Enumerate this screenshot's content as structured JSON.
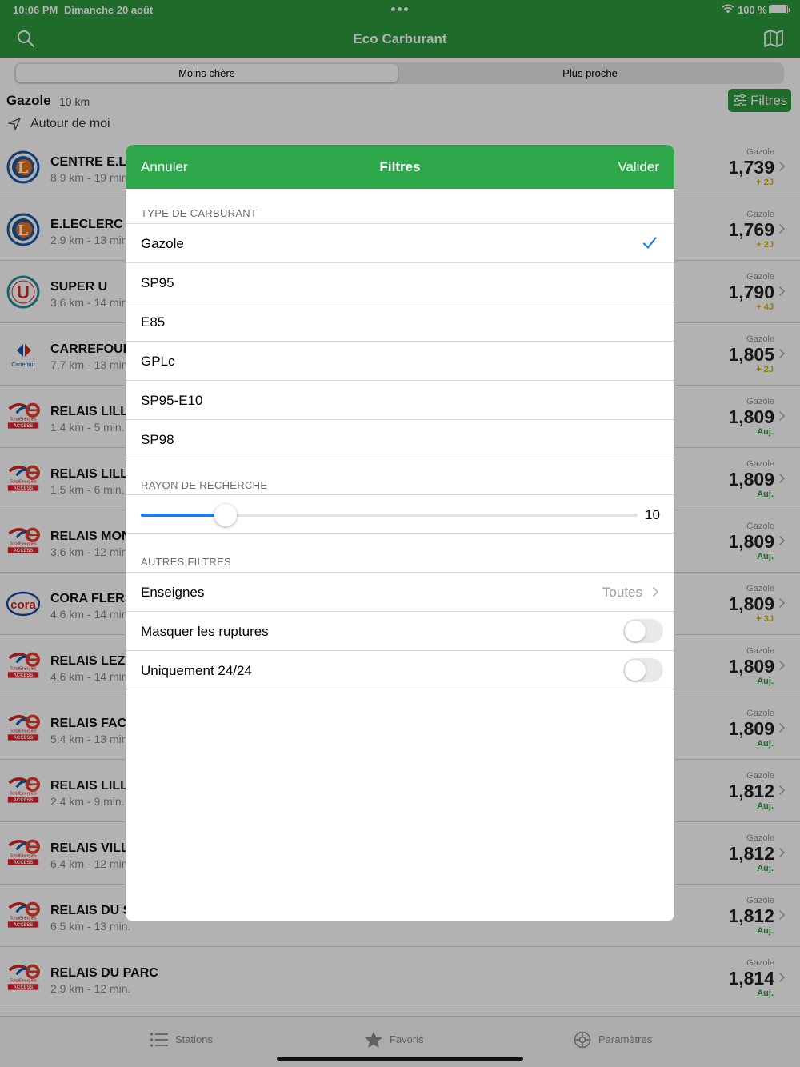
{
  "status": {
    "time": "10:06 PM",
    "date": "Dimanche 20 août",
    "battery": "100 %"
  },
  "nav": {
    "title": "Eco Carburant"
  },
  "segments": {
    "cheapest": "Moins chère",
    "nearest": "Plus proche"
  },
  "header": {
    "fuel": "Gazole",
    "radius": "10 km",
    "filters_button": "Filtres",
    "location": "Autour de moi"
  },
  "stations": [
    {
      "name": "CENTRE E.LECLERC",
      "distance": "8.9 km - 19 min.",
      "fuel": "Gazole",
      "price": "1,739",
      "age": "+ 2J",
      "logo": "leclerc-logo",
      "fresh": false
    },
    {
      "name": "E.LECLERC L",
      "distance": "2.9 km - 13 min.",
      "fuel": "Gazole",
      "price": "1,769",
      "age": "+ 2J",
      "logo": "leclerc-logo",
      "fresh": false
    },
    {
      "name": "SUPER U",
      "distance": "3.6 km - 14 min.",
      "fuel": "Gazole",
      "price": "1,790",
      "age": "+ 4J",
      "logo": "superu-logo",
      "fresh": false
    },
    {
      "name": "CARREFOUR",
      "distance": "7.7 km - 13 min.",
      "fuel": "Gazole",
      "price": "1,805",
      "age": "+ 2J",
      "logo": "carrefour-logo",
      "fresh": false
    },
    {
      "name": "RELAIS LILLE",
      "distance": "1.4 km - 5 min.",
      "fuel": "Gazole",
      "price": "1,809",
      "age": "Auj.",
      "logo": "totalenergies-logo",
      "fresh": true
    },
    {
      "name": "RELAIS LILLE",
      "distance": "1.5 km - 6 min.",
      "fuel": "Gazole",
      "price": "1,809",
      "age": "Auj.",
      "logo": "totalenergies-logo",
      "fresh": true
    },
    {
      "name": "RELAIS MON",
      "distance": "3.6 km - 12 min.",
      "fuel": "Gazole",
      "price": "1,809",
      "age": "Auj.",
      "logo": "totalenergies-logo",
      "fresh": true
    },
    {
      "name": "CORA FLERS",
      "distance": "4.6 km - 14 min.",
      "fuel": "Gazole",
      "price": "1,809",
      "age": "+ 3J",
      "logo": "cora-logo",
      "fresh": false
    },
    {
      "name": "RELAIS LEZE",
      "distance": "4.6 km - 14 min.",
      "fuel": "Gazole",
      "price": "1,809",
      "age": "Auj.",
      "logo": "totalenergies-logo",
      "fresh": true
    },
    {
      "name": "RELAIS FACH",
      "distance": "5.4 km - 13 min.",
      "fuel": "Gazole",
      "price": "1,809",
      "age": "Auj.",
      "logo": "totalenergies-logo",
      "fresh": true
    },
    {
      "name": "RELAIS LILLE",
      "distance": "2.4 km - 9 min.",
      "fuel": "Gazole",
      "price": "1,812",
      "age": "Auj.",
      "logo": "totalenergies-logo",
      "fresh": true
    },
    {
      "name": "RELAIS VILLE",
      "distance": "6.4 km - 12 min.",
      "fuel": "Gazole",
      "price": "1,812",
      "age": "Auj.",
      "logo": "totalenergies-logo",
      "fresh": true
    },
    {
      "name": "RELAIS DU S",
      "distance": "6.5 km - 13 min.",
      "fuel": "Gazole",
      "price": "1,812",
      "age": "Auj.",
      "logo": "totalenergies-logo",
      "fresh": true
    },
    {
      "name": "RELAIS DU PARC",
      "distance": "2.9 km - 12 min.",
      "fuel": "Gazole",
      "price": "1,814",
      "age": "Auj.",
      "logo": "totalenergies-logo",
      "fresh": true
    }
  ],
  "tabs": {
    "stations": "Stations",
    "favorites": "Favoris",
    "settings": "Paramètres"
  },
  "modal": {
    "cancel": "Annuler",
    "title": "Filtres",
    "confirm": "Valider",
    "fuel_section": "TYPE DE CARBURANT",
    "fuel_options": [
      "Gazole",
      "SP95",
      "E85",
      "GPLc",
      "SP95-E10",
      "SP98"
    ],
    "selected_fuel": "Gazole",
    "radius_section": "RAYON DE RECHERCHE",
    "radius_value": "10",
    "radius_fraction": 0.17,
    "other_section": "AUTRES FILTRES",
    "brands_label": "Enseignes",
    "brands_value": "Toutes",
    "hide_shortage_label": "Masquer les ruptures",
    "hide_shortage_on": false,
    "open_24_label": "Uniquement 24/24",
    "open_24_on": false
  },
  "colors": {
    "brand_green": "#2c9a3d",
    "modal_green": "#2ea84a",
    "accent_blue": "#1a7cf0",
    "age_old": "#d4b500",
    "age_fresh": "#2c9a3d"
  }
}
